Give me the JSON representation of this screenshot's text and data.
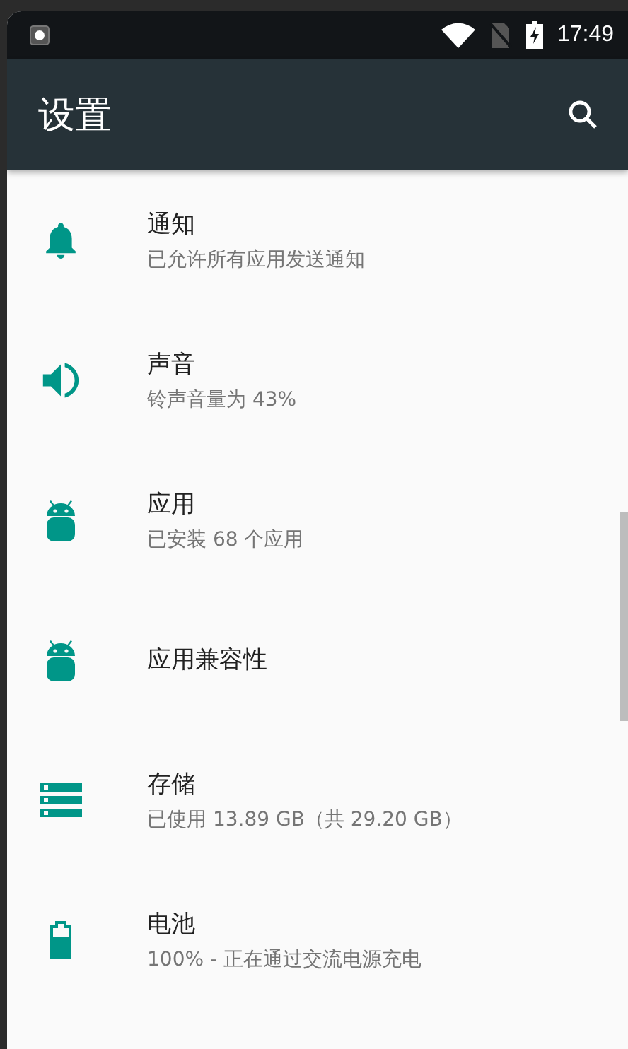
{
  "status_bar": {
    "time": "17:49"
  },
  "toolbar": {
    "title": "设置"
  },
  "items": [
    {
      "kind": "bell",
      "title": "通知",
      "subtitle": "已允许所有应用发送通知"
    },
    {
      "kind": "speaker",
      "title": "声音",
      "subtitle": "铃声音量为 43%"
    },
    {
      "kind": "android",
      "title": "应用",
      "subtitle": "已安装 68 个应用"
    },
    {
      "kind": "android",
      "title": "应用兼容性"
    },
    {
      "kind": "storage",
      "title": "存储",
      "subtitle": "已使用 13.89 GB（共 29.20 GB）"
    },
    {
      "kind": "battery",
      "title": "电池",
      "subtitle": "100% - 正在通过交流电源充电"
    }
  ]
}
